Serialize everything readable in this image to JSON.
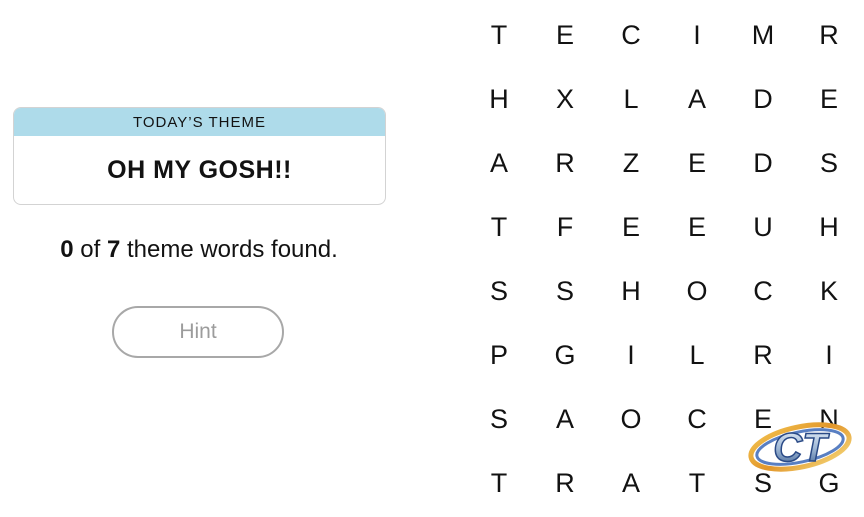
{
  "theme": {
    "header": "TODAY’S THEME",
    "title": "OH MY GOSH!!"
  },
  "progress": {
    "found": "0",
    "of_text": " of ",
    "total": "7",
    "suffix": " theme words found."
  },
  "hint_button": {
    "label": "Hint"
  },
  "grid": {
    "rows": [
      [
        "T",
        "E",
        "C",
        "I",
        "M",
        "R"
      ],
      [
        "H",
        "X",
        "L",
        "A",
        "D",
        "E"
      ],
      [
        "A",
        "R",
        "Z",
        "E",
        "D",
        "S"
      ],
      [
        "T",
        "F",
        "E",
        "E",
        "U",
        "H"
      ],
      [
        "S",
        "S",
        "H",
        "O",
        "C",
        "K"
      ],
      [
        "P",
        "G",
        "I",
        "L",
        "R",
        "I"
      ],
      [
        "S",
        "A",
        "O",
        "C",
        "E",
        "N"
      ],
      [
        "T",
        "R",
        "A",
        "T",
        "S",
        "G"
      ]
    ]
  },
  "watermark": {
    "text": "CT",
    "icon": "ct-logo-icon"
  }
}
